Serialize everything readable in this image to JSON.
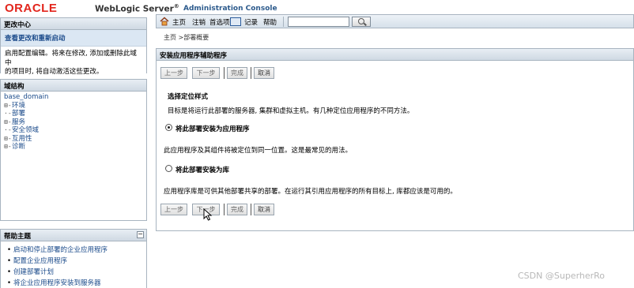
{
  "header": {
    "logo": "ORACLE",
    "product": "WebLogic Server",
    "registered": "®",
    "subtitle": "Administration Console"
  },
  "change_center": {
    "title": "更改中心",
    "link": "查看更改和重新启动",
    "text_line1": "启用配置编辑。将来在修改, 添加或删除此域中",
    "text_line2": "的项目时, 将自动激活这些更改。"
  },
  "domain_structure": {
    "title": "域结构",
    "root": "base_domain",
    "nodes": [
      {
        "prefix": "⊞-",
        "label": "环境"
      },
      {
        "prefix": "·-",
        "label": "部署"
      },
      {
        "prefix": "⊞-",
        "label": "服务"
      },
      {
        "prefix": "·-",
        "label": "安全领域"
      },
      {
        "prefix": "⊞-",
        "label": "互用性"
      },
      {
        "prefix": "⊞-",
        "label": "诊断"
      }
    ]
  },
  "help_topics": {
    "title": "帮助主题",
    "collapse": "⊟",
    "items": [
      "启动和停止部署的企业应用程序",
      "配置企业应用程序",
      "创建部署计划",
      "将企业应用程序安装到服务器"
    ]
  },
  "toolbar": {
    "home": "主页",
    "logout": "注销",
    "preferences": "首选项",
    "record": "记录",
    "help": "帮助",
    "search_value": ""
  },
  "breadcrumb": "主页 >部署概要",
  "assistant": {
    "title": "安装应用程序辅助程序",
    "buttons": {
      "back": "上一步",
      "next": "下一步",
      "finish": "完成",
      "cancel": "取消"
    },
    "section_title": "选择定位样式",
    "description": "目标是将运行此部署的服务器, 集群和虚拟主机。有几种定位应用程序的不同方法。",
    "option1_label": "将此部署安装为应用程序",
    "option1_desc": "此应用程序及其组件将被定位到同一位置。这是最常见的用法。",
    "option2_label": "将此部署安装为库",
    "option2_desc": "应用程序库是可供其他部署共享的部署。在运行其引用应用程序的所有目标上, 库都应该是可用的。"
  },
  "watermark": "CSDN @SuperherRo"
}
